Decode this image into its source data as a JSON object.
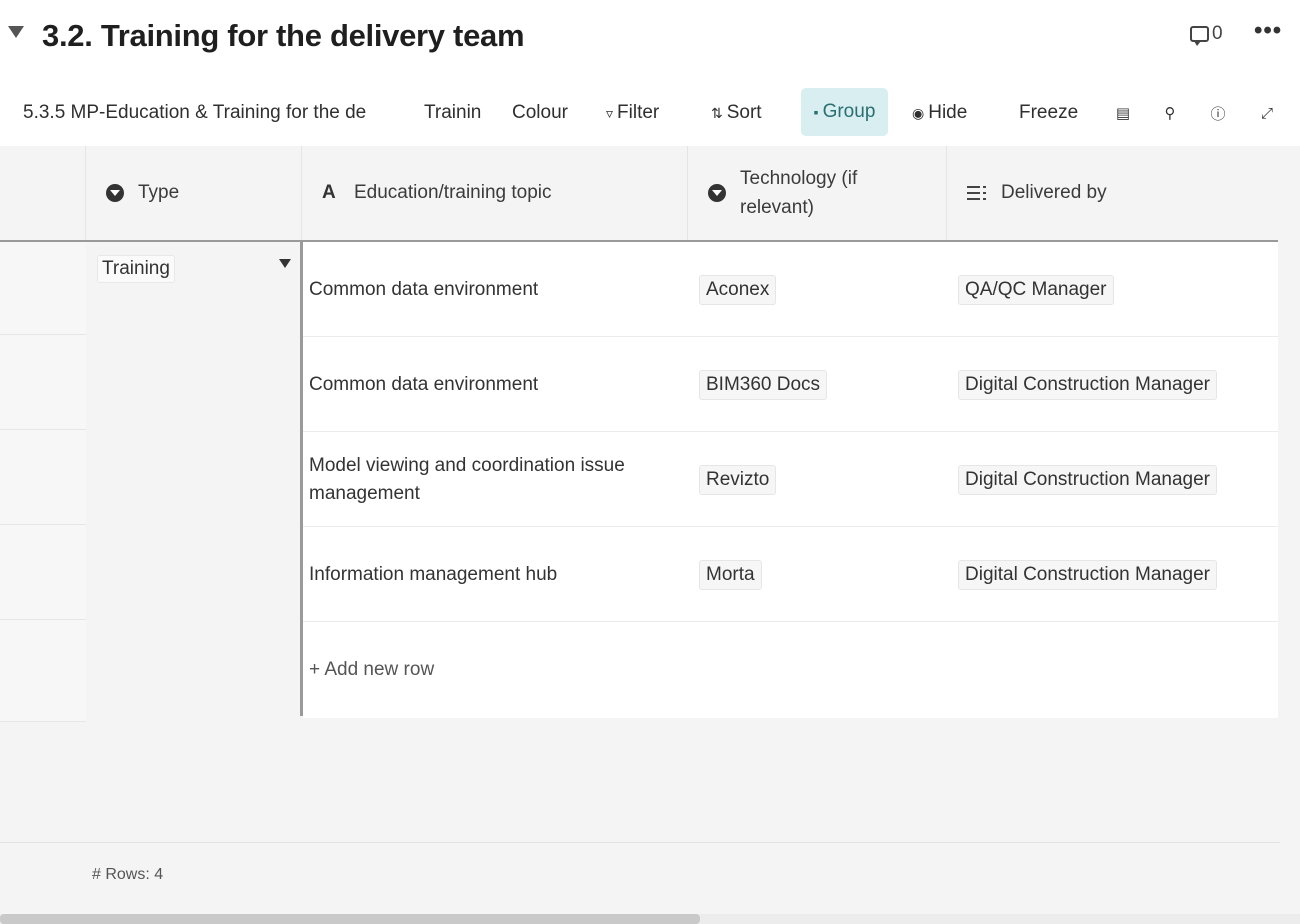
{
  "section": {
    "title": "3.2. Training for the delivery team",
    "comment_count": "0",
    "more_label": "•••"
  },
  "toolbar": {
    "table_name": "5.3.5 MP-Education & Training for the de",
    "view_name": "Trainin",
    "colour_label": "Colour",
    "filter_label": "Filter",
    "sort_label": "Sort",
    "group_label": "Group",
    "hide_label": "Hide",
    "freeze_label": "Freeze"
  },
  "columns": {
    "type": "Type",
    "topic": "Education/training topic",
    "tech_line1": "Technology (if",
    "tech_line2": "relevant)",
    "delivered": "Delivered by"
  },
  "group": {
    "value": "Training"
  },
  "rows": [
    {
      "topic": "Common data environment",
      "technology": "Aconex",
      "delivered_by": "QA/QC Manager"
    },
    {
      "topic": "Common data environment",
      "technology": "BIM360 Docs",
      "delivered_by": "Digital Construction Manager"
    },
    {
      "topic": "Model viewing and coordination issue management",
      "technology": "Revizto",
      "delivered_by": "Digital Construction Manager"
    },
    {
      "topic": "Information management hub",
      "technology": "Morta",
      "delivered_by": "Digital Construction Manager"
    }
  ],
  "add_row_label": "+ Add new row",
  "footer": {
    "row_count_label": "# Rows: 4"
  },
  "colors": {
    "group_active_bg": "#d8eef0",
    "group_active_text": "#2a6f72"
  }
}
